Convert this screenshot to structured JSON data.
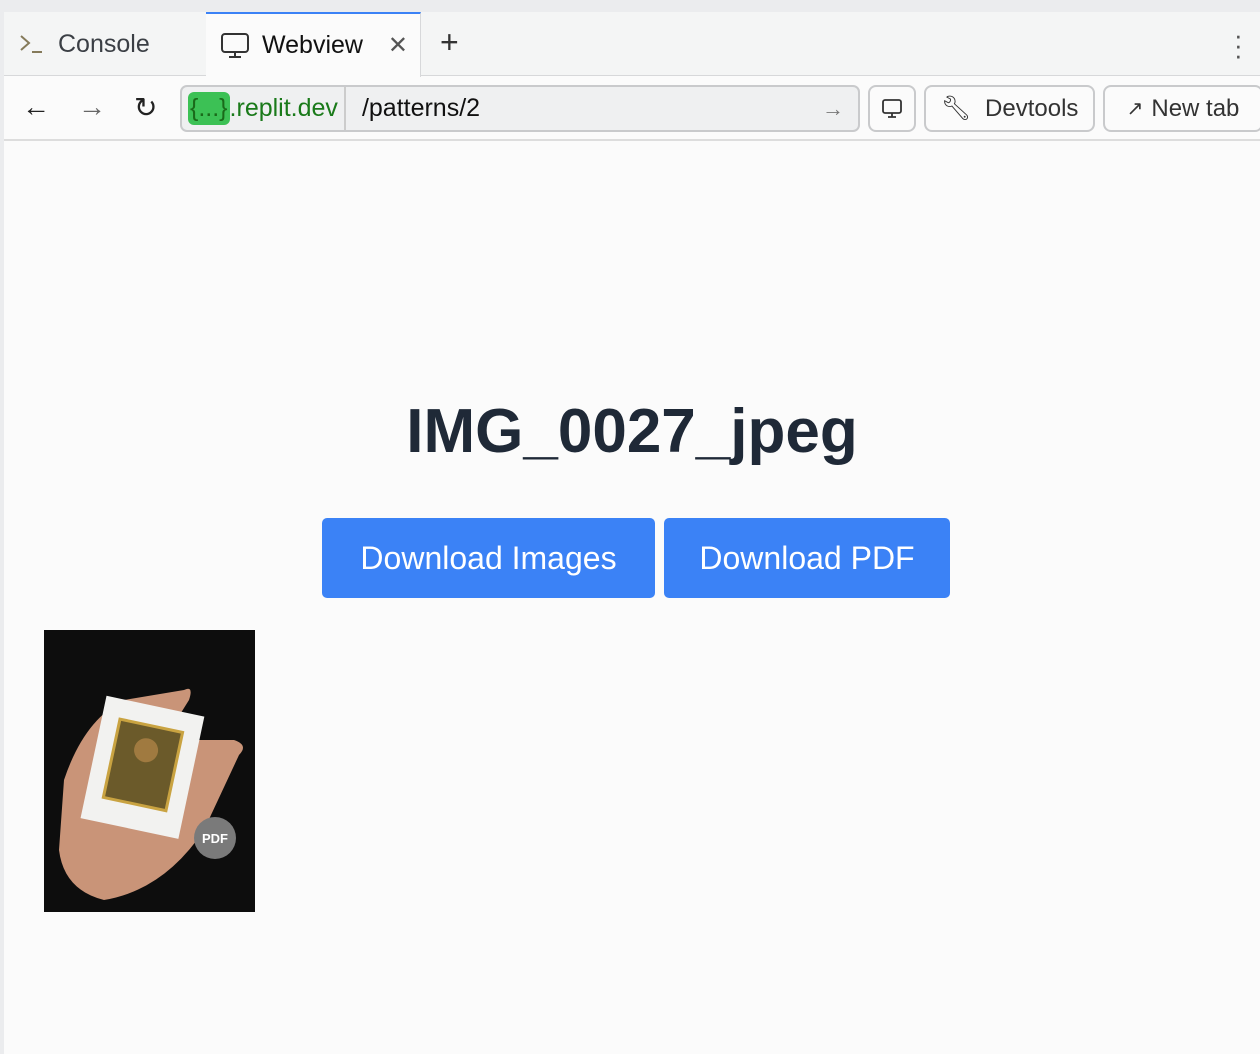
{
  "tabs": [
    {
      "label": "Console",
      "icon": "terminal-icon"
    },
    {
      "label": "Webview",
      "icon": "monitor-icon",
      "active": true
    }
  ],
  "nav": {
    "host_badge": "{...}",
    "host": ".replit.dev",
    "path": "/patterns/2",
    "devtools": "Devtools",
    "new_tab": "New tab"
  },
  "page": {
    "title": "IMG_0027_jpeg",
    "download_images": "Download Images",
    "download_pdf": "Download PDF",
    "thumb_badge": "PDF"
  },
  "colors": {
    "accent": "#3b82f6",
    "host": "#1a7a1a"
  }
}
